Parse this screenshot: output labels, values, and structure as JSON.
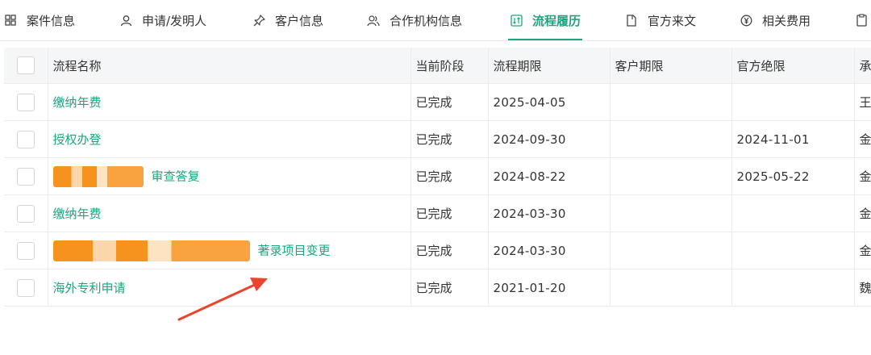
{
  "tabs": [
    {
      "label": "案件信息",
      "icon": "grid-icon"
    },
    {
      "label": "申请/发明人",
      "icon": "person-icon"
    },
    {
      "label": "客户信息",
      "icon": "pin-icon"
    },
    {
      "label": "合作机构信息",
      "icon": "people-icon"
    },
    {
      "label": "流程履历",
      "icon": "workflow-icon",
      "active": true
    },
    {
      "label": "官方来文",
      "icon": "document-icon"
    },
    {
      "label": "相关费用",
      "icon": "yen-icon"
    },
    {
      "label": "",
      "icon": "clipboard-icon"
    }
  ],
  "table": {
    "headers": [
      "流程名称",
      "当前阶段",
      "流程期限",
      "客户期限",
      "官方绝限",
      "承"
    ],
    "rows": [
      {
        "name": "缴纳年费",
        "stage": "已完成",
        "process_deadline": "2025-04-05",
        "client_deadline": "",
        "official_deadline": "",
        "handler": "王"
      },
      {
        "name": "授权办登",
        "stage": "已完成",
        "process_deadline": "2024-09-30",
        "client_deadline": "",
        "official_deadline": "2024-11-01",
        "handler": "金"
      },
      {
        "name": "审查答复",
        "stage": "已完成",
        "process_deadline": "2024-08-22",
        "client_deadline": "",
        "official_deadline": "2025-05-22",
        "handler": "金",
        "redacted": true
      },
      {
        "name": "缴纳年费",
        "stage": "已完成",
        "process_deadline": "2024-03-30",
        "client_deadline": "",
        "official_deadline": "",
        "handler": "金"
      },
      {
        "name": "著录项目变更",
        "stage": "已完成",
        "process_deadline": "2024-03-30",
        "client_deadline": "",
        "official_deadline": "",
        "handler": "金",
        "redacted": true
      },
      {
        "name": "海外专利申请",
        "stage": "已完成",
        "process_deadline": "2021-01-20",
        "client_deadline": "",
        "official_deadline": "",
        "handler": "魏"
      }
    ]
  },
  "colors": {
    "accent": "#1aa67f",
    "annotation": "#e8442e",
    "redaction": "#f6931e"
  }
}
